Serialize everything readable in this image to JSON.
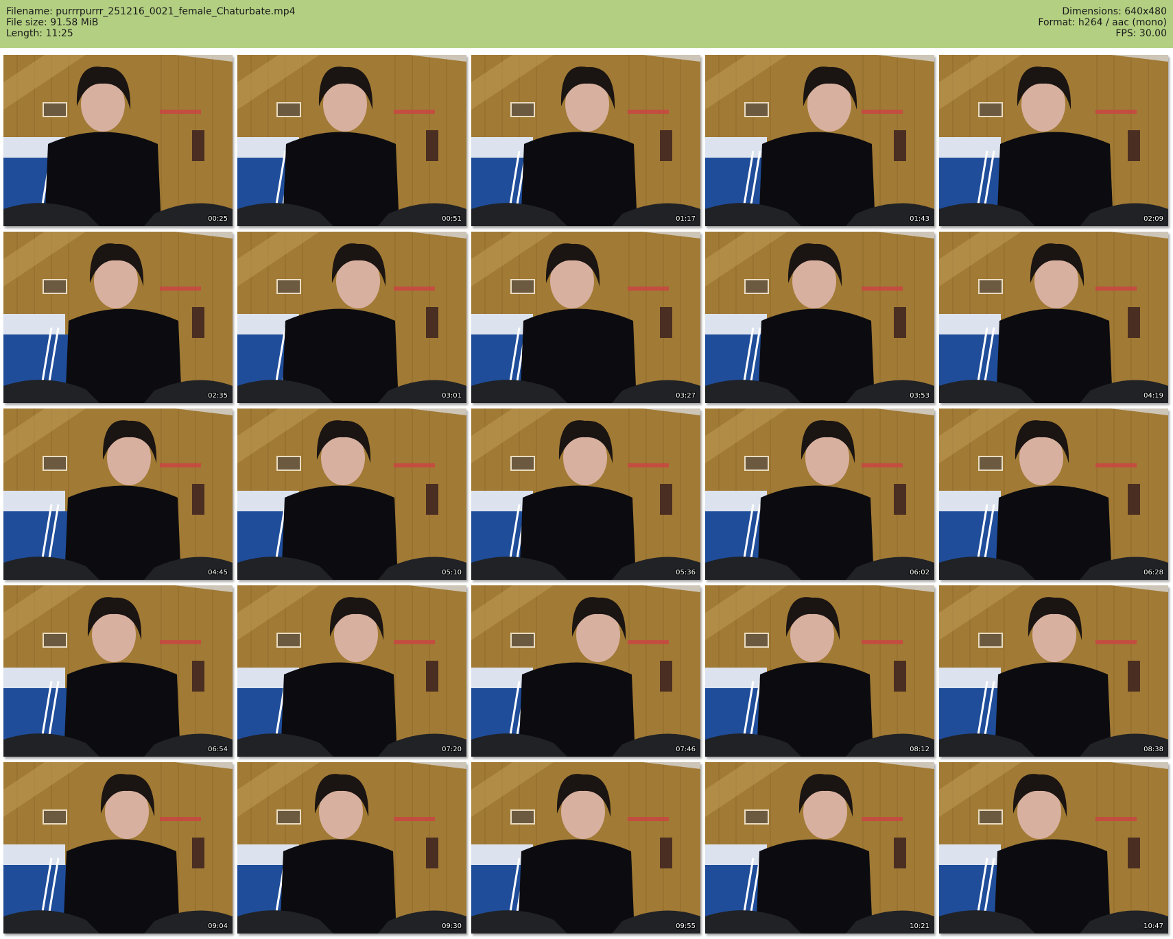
{
  "header": {
    "filename": "Filename: purrrpurrr_251216_0021_female_Chaturbate.mp4",
    "filesize": "File size: 91.58 MiB",
    "length": "Length: 11:25",
    "dimensions": "Dimensions: 640x480",
    "format": "Format: h264 / aac (mono)",
    "fps": "FPS: 30.00"
  },
  "colors": {
    "header_bg": "#b3cf82",
    "wood": "#a17a35",
    "blanket": "#1f4d9a",
    "sweater": "#0c0c10"
  },
  "thumbnails": [
    {
      "time": "00:25"
    },
    {
      "time": "00:51"
    },
    {
      "time": "01:17"
    },
    {
      "time": "01:43"
    },
    {
      "time": "02:09"
    },
    {
      "time": "02:35"
    },
    {
      "time": "03:01"
    },
    {
      "time": "03:27"
    },
    {
      "time": "03:53"
    },
    {
      "time": "04:19"
    },
    {
      "time": "04:45"
    },
    {
      "time": "05:10"
    },
    {
      "time": "05:36"
    },
    {
      "time": "06:02"
    },
    {
      "time": "06:28"
    },
    {
      "time": "06:54"
    },
    {
      "time": "07:20"
    },
    {
      "time": "07:46"
    },
    {
      "time": "08:12"
    },
    {
      "time": "08:38"
    },
    {
      "time": "09:04"
    },
    {
      "time": "09:30"
    },
    {
      "time": "09:55"
    },
    {
      "time": "10:21"
    },
    {
      "time": "10:47"
    }
  ]
}
